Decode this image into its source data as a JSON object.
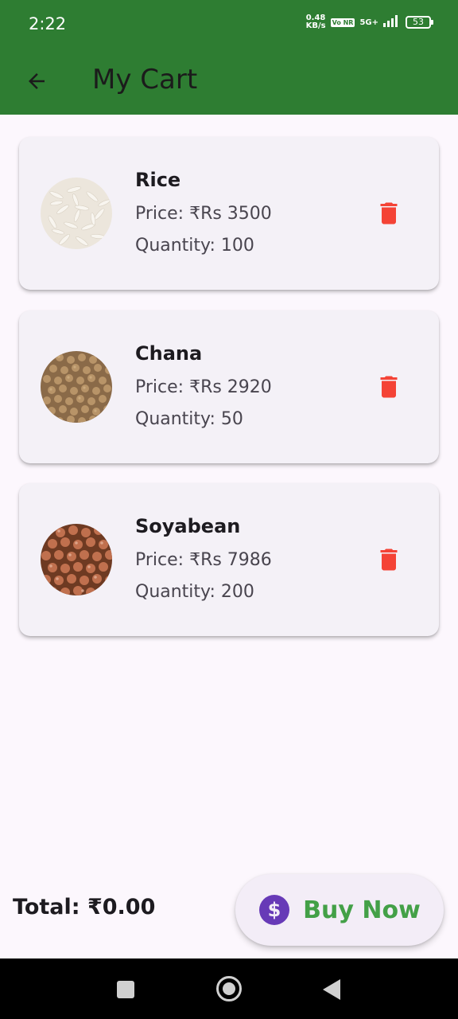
{
  "status_bar": {
    "time": "2:22",
    "net_speed_value": "0.48",
    "net_speed_unit": "KB/s",
    "volte": "Vo NR",
    "network": "5G+",
    "battery": "53"
  },
  "app_bar": {
    "title": "My Cart",
    "back_icon": "arrow-left-icon",
    "color": "#2e7d32"
  },
  "cart": {
    "items": [
      {
        "name": "Rice",
        "price": "Price: ₹Rs 3500",
        "quantity": "Quantity: 100",
        "image": "rice-grains",
        "delete_icon": "trash-icon"
      },
      {
        "name": "Chana",
        "price": "Price: ₹Rs 2920",
        "quantity": "Quantity: 50",
        "image": "chana-grains",
        "delete_icon": "trash-icon"
      },
      {
        "name": "Soyabean",
        "price": "Price: ₹Rs 7986",
        "quantity": "Quantity: 200",
        "image": "soyabean-grains",
        "delete_icon": "trash-icon"
      }
    ]
  },
  "footer": {
    "total": "Total: ₹0.00",
    "buy_label": "Buy Now",
    "buy_icon": "dollar-circle-icon",
    "buy_color": "#43a047",
    "delete_color": "#f44336"
  },
  "nav_bar": {
    "recents_icon": "square-icon",
    "home_icon": "circle-icon",
    "back_icon": "triangle-back-icon"
  }
}
